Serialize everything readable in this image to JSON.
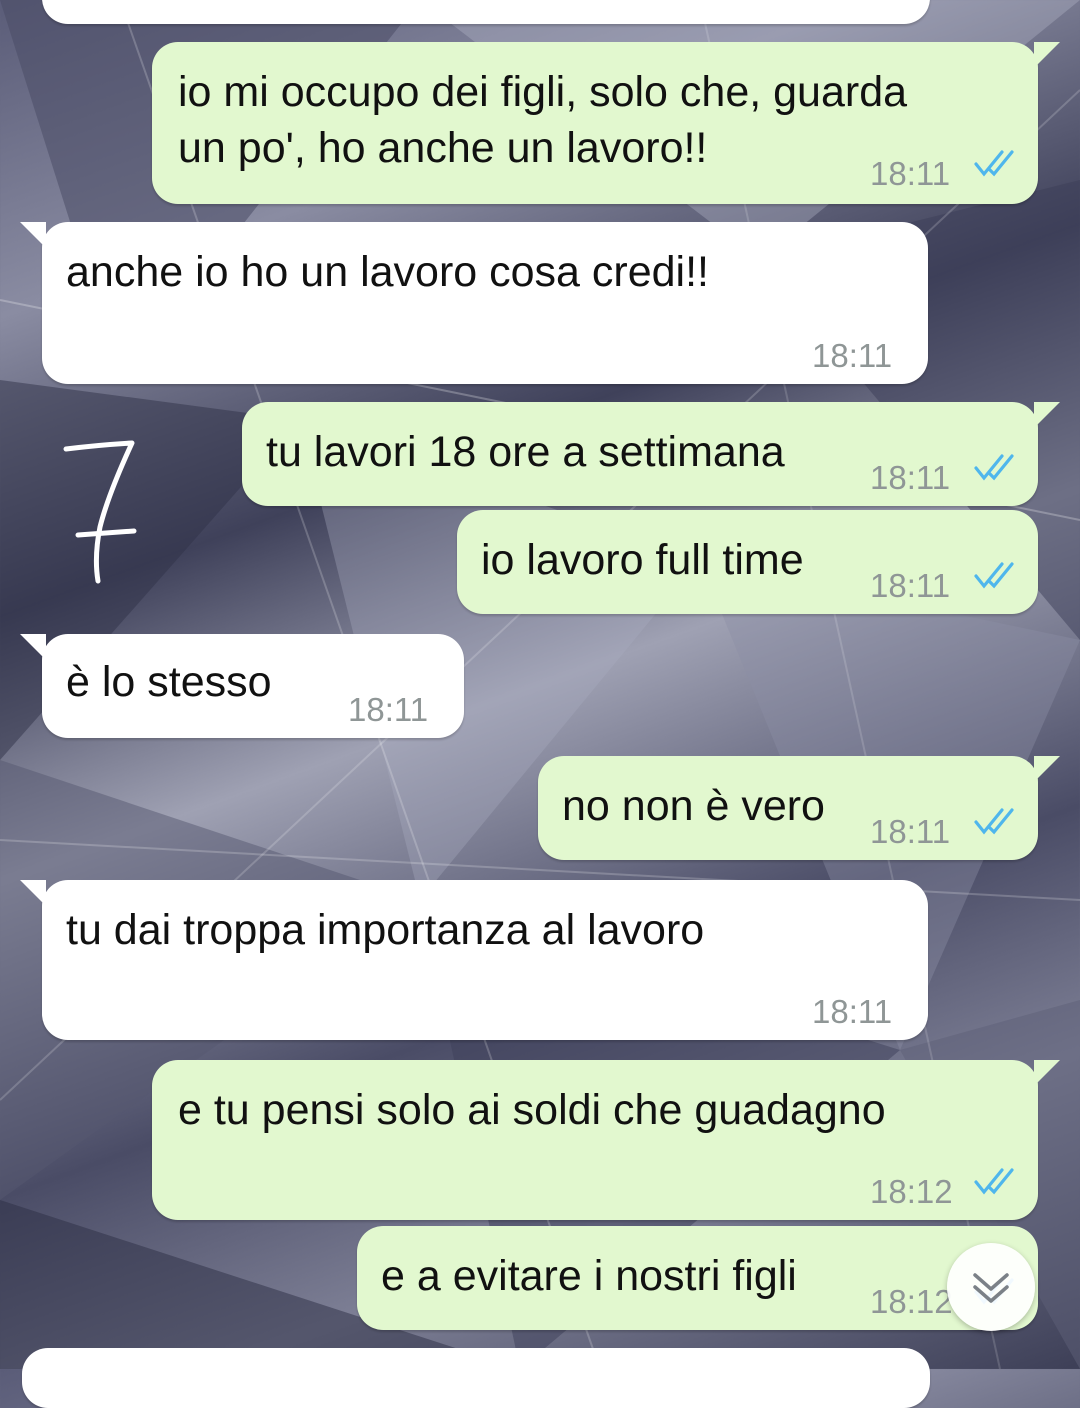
{
  "chat": {
    "messages": [
      {
        "id": "m0",
        "direction": "in",
        "text": "",
        "time": ""
      },
      {
        "id": "m1",
        "direction": "out",
        "text": "io mi occupo dei figli, solo che, guarda\nun po', ho anche un lavoro!!",
        "time": "18:11",
        "status": "read"
      },
      {
        "id": "m2",
        "direction": "in",
        "text": "anche io ho un lavoro cosa credi!!",
        "time": "18:11"
      },
      {
        "id": "m3",
        "direction": "out",
        "text": "tu lavori 18 ore a settimana",
        "time": "18:11",
        "status": "read"
      },
      {
        "id": "m4",
        "direction": "out",
        "text": "io lavoro full time",
        "time": "18:11",
        "status": "read"
      },
      {
        "id": "m5",
        "direction": "in",
        "text": "è lo stesso",
        "time": "18:11"
      },
      {
        "id": "m6",
        "direction": "out",
        "text": "no non è vero",
        "time": "18:11",
        "status": "read"
      },
      {
        "id": "m7",
        "direction": "in",
        "text": "tu dai troppa importanza al lavoro",
        "time": "18:11"
      },
      {
        "id": "m8",
        "direction": "out",
        "text": "e tu pensi solo ai soldi che guadagno",
        "time": "18:12",
        "status": "read"
      },
      {
        "id": "m9",
        "direction": "out",
        "text": "e a evitare i nostri figli",
        "time": "18:12",
        "status": "read"
      }
    ]
  },
  "overlay": {
    "handwritten_number": "7",
    "scroll_button_icon": "chevron-down-double-icon"
  },
  "colors": {
    "incoming_bubble": "#ffffff",
    "outgoing_bubble": "#e2f8cf",
    "read_ticks": "#4fb6ec",
    "timestamp": "#8f9696"
  }
}
